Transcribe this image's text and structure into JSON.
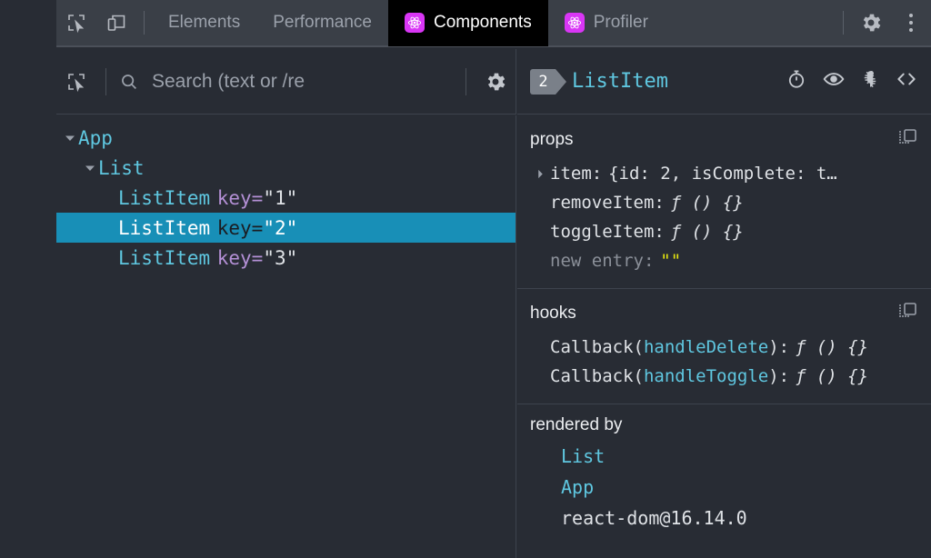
{
  "tabbar": {
    "inspect_icon": "inspect-element-icon",
    "device_icon": "device-toolbar-icon",
    "tabs": [
      {
        "label": "Elements",
        "active": false,
        "react": false
      },
      {
        "label": "Performance",
        "active": false,
        "react": false
      },
      {
        "label": "Components",
        "active": true,
        "react": true
      },
      {
        "label": "Profiler",
        "active": false,
        "react": true
      }
    ],
    "settings_icon": "gear-icon",
    "more_icon": "kebab-menu-icon"
  },
  "searchbar": {
    "inspect_icon": "inspect-element-icon",
    "search_icon": "search-icon",
    "placeholder": "Search (text or /re",
    "value": "",
    "settings_icon": "gear-icon"
  },
  "selection_header": {
    "index_badge": "2",
    "component_name": "ListItem",
    "icons": [
      "timer-icon",
      "eye-icon",
      "bug-icon",
      "code-brackets-icon"
    ]
  },
  "tree": {
    "rows": [
      {
        "indent": 0,
        "arrow": "down",
        "name": "App",
        "attr": "",
        "value": "",
        "selected": false
      },
      {
        "indent": 1,
        "arrow": "down",
        "name": "List",
        "attr": "",
        "value": "",
        "selected": false
      },
      {
        "indent": 2,
        "arrow": "none",
        "name": "ListItem",
        "attr": "key=",
        "value": "\"1\"",
        "selected": false
      },
      {
        "indent": 2,
        "arrow": "none",
        "name": "ListItem",
        "attr": "key=",
        "value": "\"2\"",
        "selected": true
      },
      {
        "indent": 2,
        "arrow": "none",
        "name": "ListItem",
        "attr": "key=",
        "value": "\"3\"",
        "selected": false
      }
    ],
    "selection_color": "#188fb7"
  },
  "props": {
    "title": "props",
    "copy_icon": "copy-to-clipboard-icon",
    "rows": [
      {
        "expandable": true,
        "name": "item:",
        "value": "{id: 2, isComplete: t…",
        "kind": "obj",
        "dim": false
      },
      {
        "expandable": false,
        "name": "removeItem:",
        "value": "ƒ () {}",
        "kind": "fn",
        "dim": false
      },
      {
        "expandable": false,
        "name": "toggleItem:",
        "value": "ƒ () {}",
        "kind": "fn",
        "dim": false
      },
      {
        "expandable": false,
        "name": "new entry:",
        "value": "\"\"",
        "kind": "str",
        "dim": true
      }
    ]
  },
  "hooks": {
    "title": "hooks",
    "copy_icon": "copy-to-clipboard-icon",
    "rows": [
      {
        "prefix": "Callback(",
        "hook": "handleDelete",
        "suffix": "):",
        "value": "ƒ () {}"
      },
      {
        "prefix": "Callback(",
        "hook": "handleToggle",
        "suffix": "):",
        "value": "ƒ () {}"
      }
    ]
  },
  "rendered_by": {
    "title": "rendered by",
    "rows": [
      {
        "label": "List",
        "link": true
      },
      {
        "label": "App",
        "link": true
      },
      {
        "label": "react-dom@16.14.0",
        "link": false
      }
    ]
  },
  "colors": {
    "bg": "#282c34",
    "tabbar_bg": "#3a3f47",
    "active_tab_bg": "#000000",
    "react_purple": "#d936f5",
    "cyan": "#5fc7e0",
    "purple_attr": "#b490d6",
    "string_yellow": "#e5e510",
    "selection": "#188fb7"
  }
}
